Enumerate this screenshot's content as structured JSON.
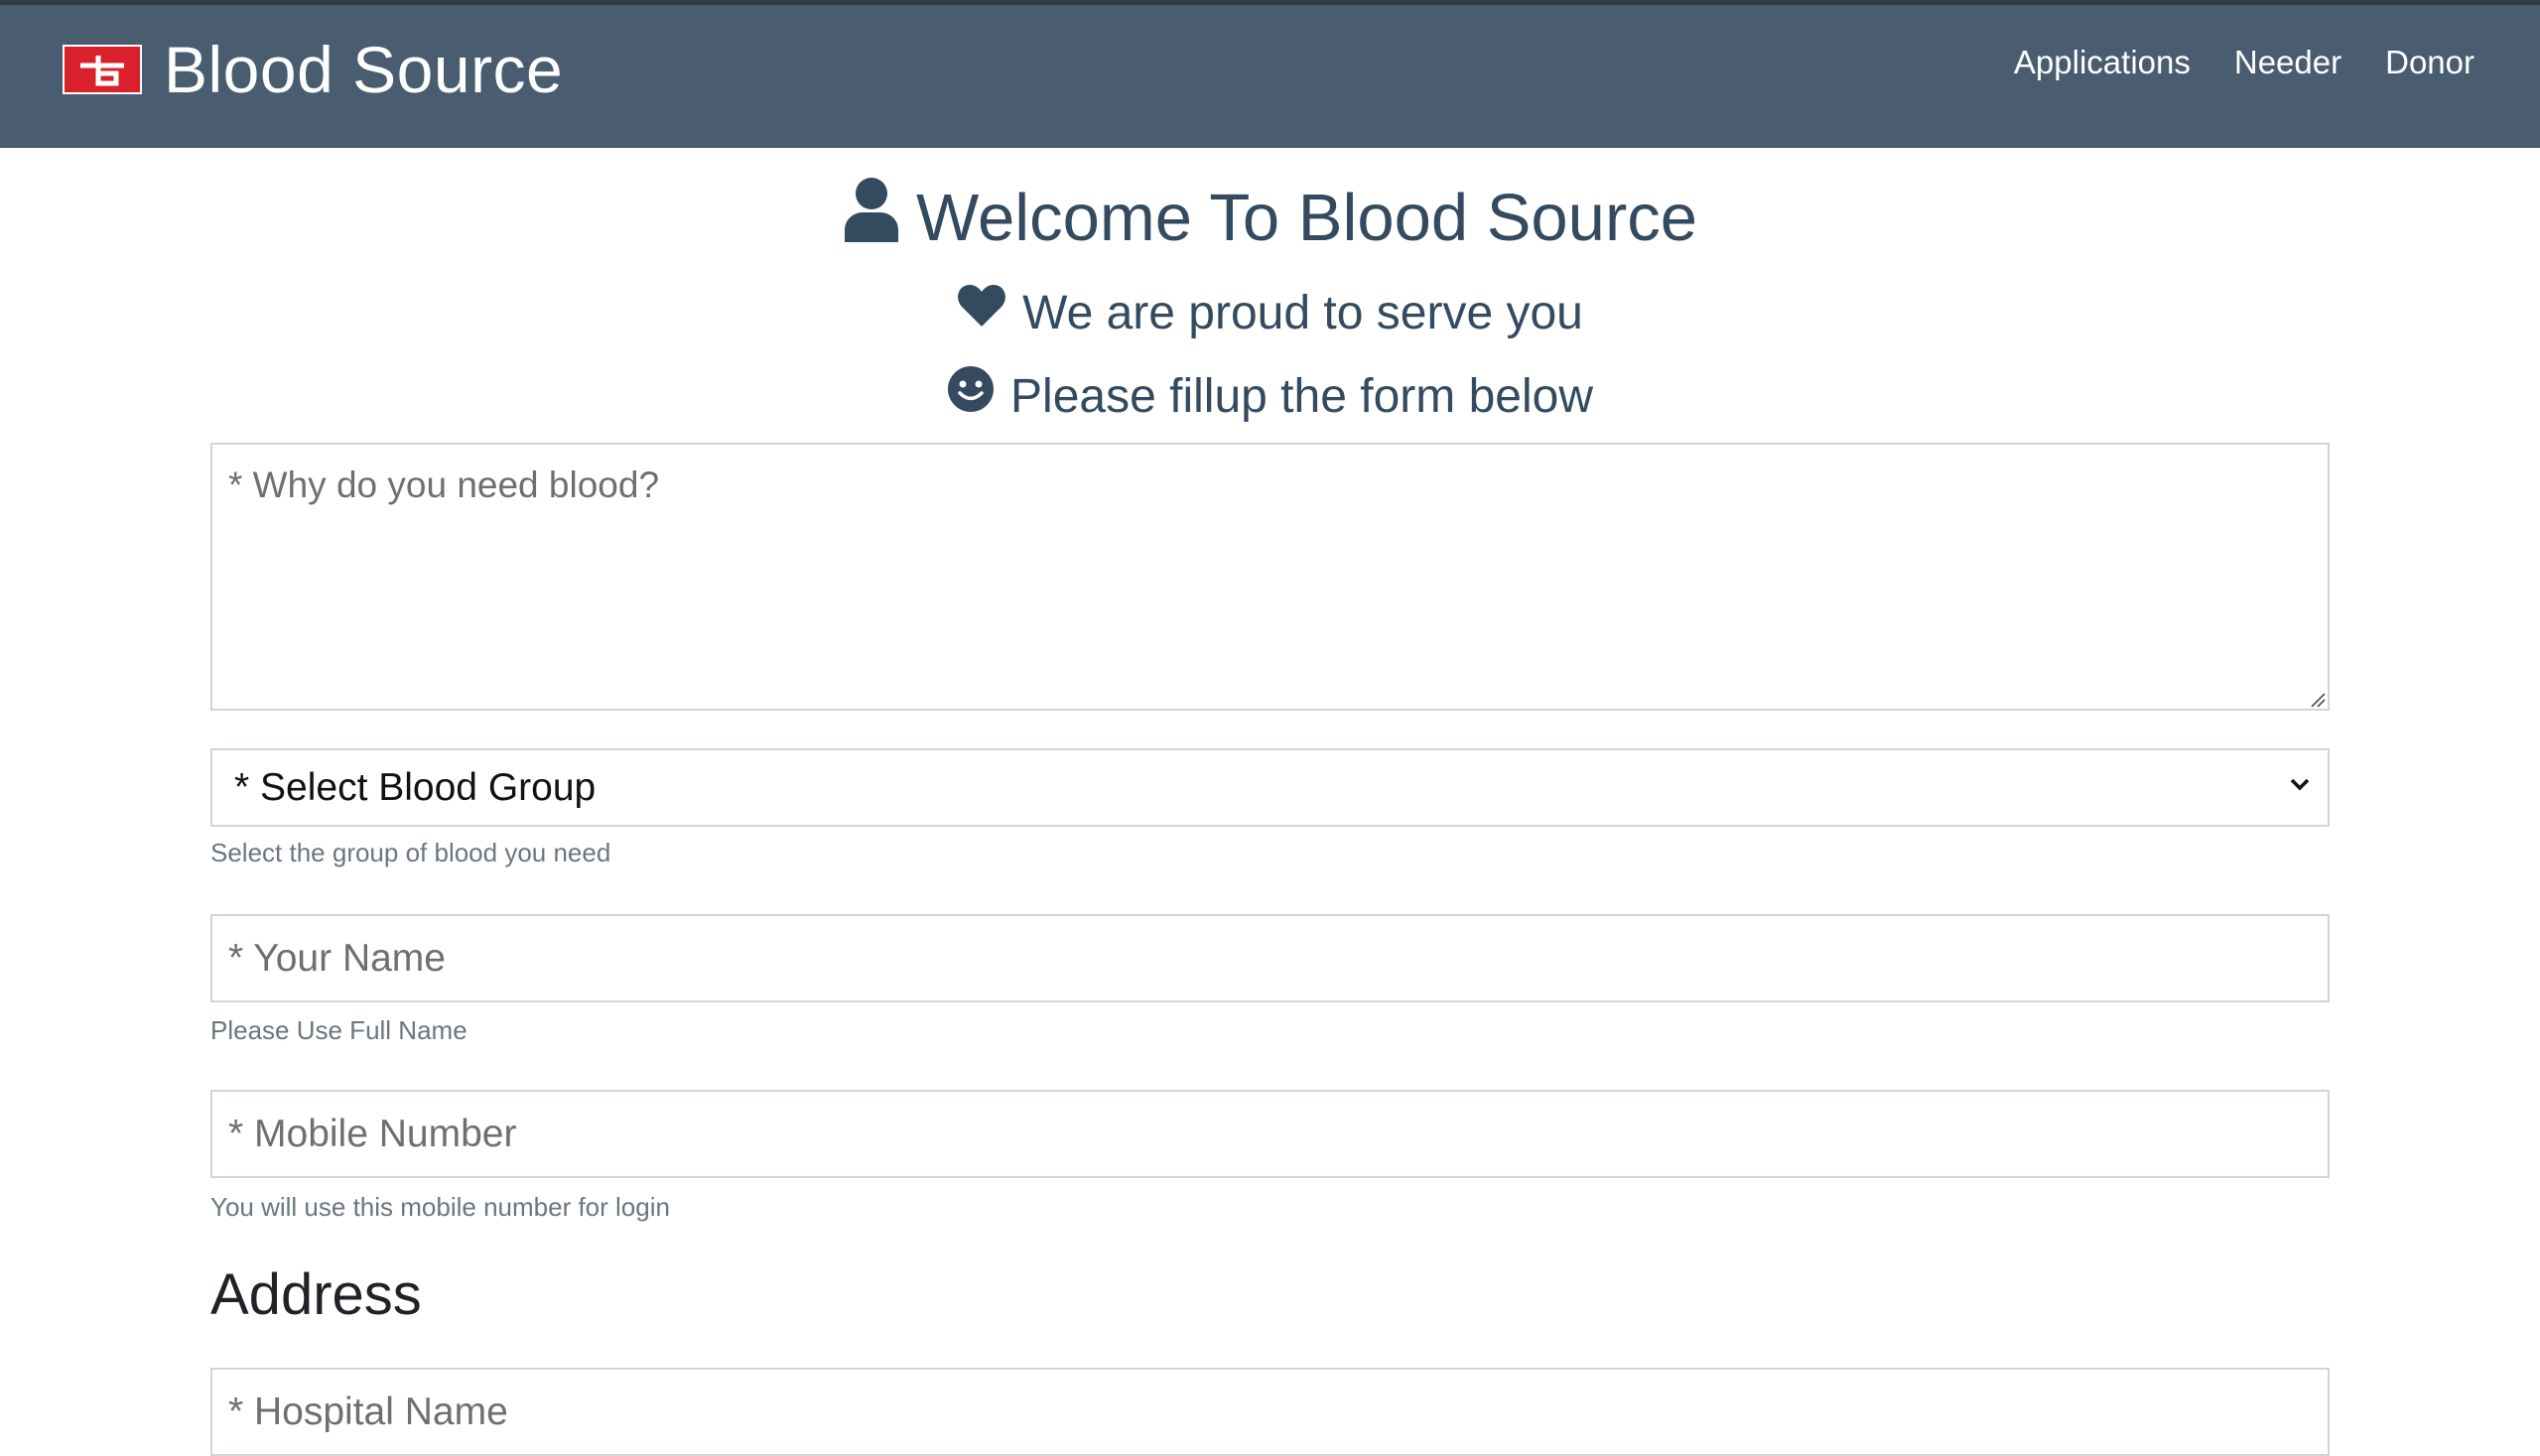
{
  "app": {
    "title": "Blood Source",
    "logo_icon": "blood-source-logo-icon",
    "accent_color": "#d9212b",
    "navbar_color": "#4a5d70"
  },
  "nav": {
    "items": [
      {
        "label": "Applications"
      },
      {
        "label": "Needer"
      },
      {
        "label": "Donor"
      }
    ]
  },
  "hero": {
    "title": "Welcome To Blood Source",
    "title_icon": "user-icon",
    "subtitle": "We are proud to serve you",
    "subtitle_icon": "heart-icon",
    "instruction": "Please fillup the form below",
    "instruction_icon": "smile-icon"
  },
  "form": {
    "reason": {
      "placeholder": "* Why do you need blood?",
      "value": ""
    },
    "blood_group": {
      "selected": "* Select Blood Group",
      "help": "Select the group of blood you need"
    },
    "name": {
      "placeholder": "* Your Name",
      "value": "",
      "help": "Please Use Full Name"
    },
    "mobile": {
      "placeholder": "* Mobile Number",
      "value": "",
      "help": "You will use this mobile number for login"
    },
    "address_heading": "Address",
    "hospital": {
      "placeholder": "* Hospital Name",
      "value": ""
    }
  }
}
